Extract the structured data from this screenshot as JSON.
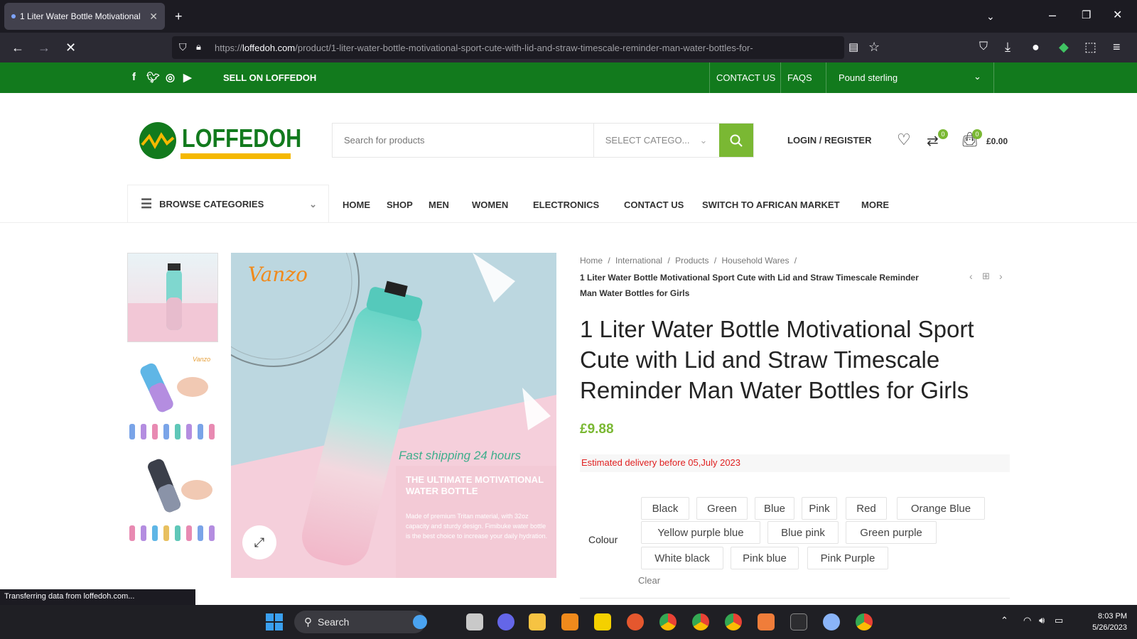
{
  "browser": {
    "tab_title": "1 Liter Water Bottle Motivational",
    "url_prefix": "https://",
    "url_host": "loffedoh.com",
    "url_path": "/product/1-liter-water-bottle-motivational-sport-cute-with-lid-and-straw-timescale-reminder-man-water-bottles-for-",
    "status_text": "Transferring data from loffedoh.com..."
  },
  "topbar": {
    "sell_label": "SELL ON LOFFEDOH",
    "contact_label": "CONTACT US",
    "faqs_label": "FAQS",
    "currency": "Pound sterling"
  },
  "header": {
    "logo_text": "LOFFEDOH",
    "search_placeholder": "Search for products",
    "category_placeholder": "SELECT CATEGO...",
    "login_label": "LOGIN / REGISTER",
    "compare_count": "0",
    "cart_count": "0",
    "cart_total": "£0.00"
  },
  "menu": {
    "browse_label": "BROWSE CATEGORIES",
    "items": [
      "HOME",
      "SHOP",
      "MEN",
      "WOMEN",
      "ELECTRONICS",
      "CONTACT US",
      "SWITCH TO AFRICAN MARKET",
      "MORE"
    ]
  },
  "gallery": {
    "brand_mark": "Vanzo",
    "promo_line": "Fast shipping 24 hours",
    "promo_title": "THE ULTIMATE MOTIVATIONAL WATER BOTTLE",
    "promo_body": "Made of premium Tritan material, with 32oz capacity and sturdy design. Fimibuke water bottle is the best choice to increase your daily hydration.",
    "thumb2_tag": "Vanzo"
  },
  "product": {
    "breadcrumb": [
      "Home",
      "International",
      "Products",
      "Household Wares"
    ],
    "breadcrumb_current": "1 Liter Water Bottle Motivational Sport Cute with Lid and Straw Timescale Reminder Man Water Bottles for Girls",
    "title": "1 Liter Water Bottle Motivational Sport Cute with Lid and Straw Timescale Reminder Man Water Bottles for Girls",
    "price": "£9.88",
    "delivery": "Estimated delivery before 05,July 2023",
    "colour_label": "Colour",
    "colours": [
      "Black",
      "Green",
      "Blue",
      "Pink",
      "Red",
      "Orange Blue",
      "Yellow purple blue",
      "Blue pink",
      "Green purple",
      "White black",
      "Pink blue",
      "Pink Purple"
    ],
    "clear_label": "Clear"
  },
  "taskbar": {
    "search_label": "Search",
    "time": "8:03 PM",
    "date": "5/26/2023"
  }
}
